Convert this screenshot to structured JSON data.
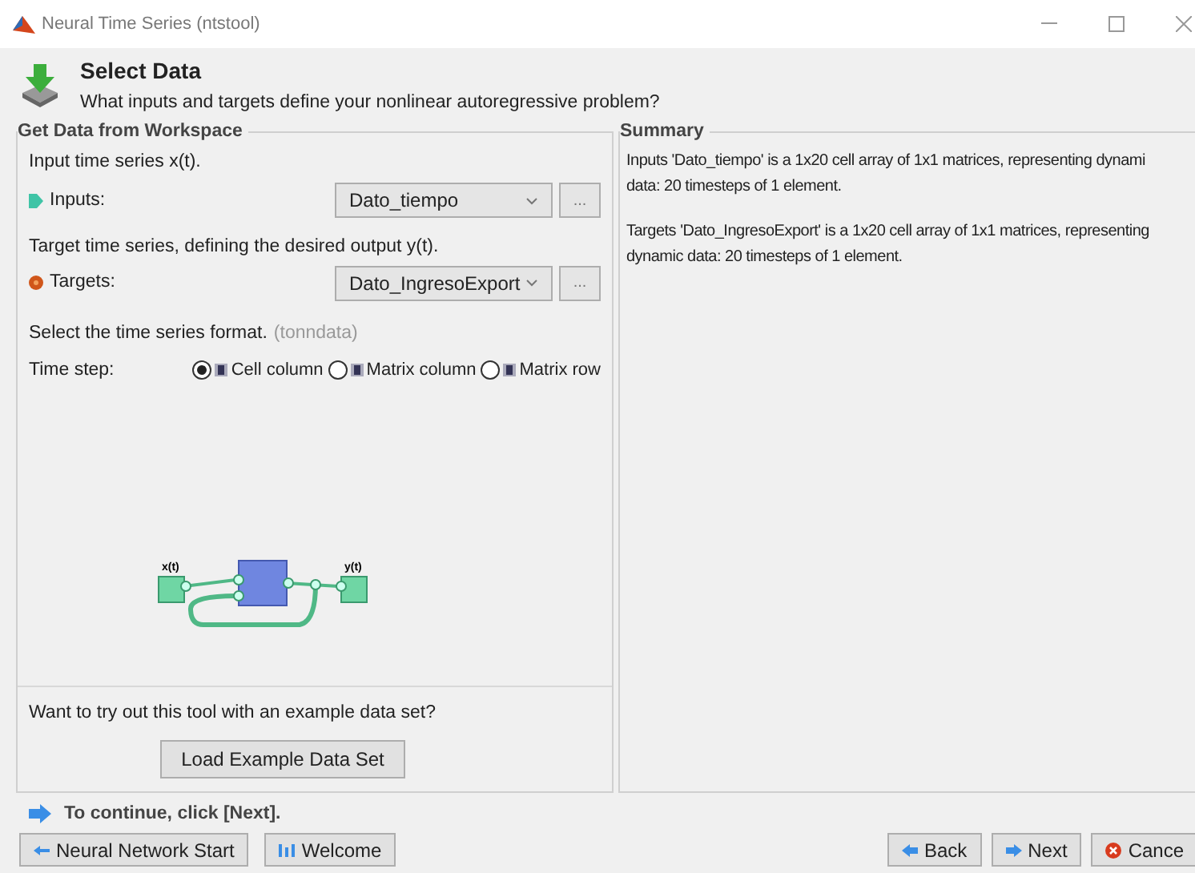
{
  "window": {
    "title": "Neural Time Series (ntstool)"
  },
  "header": {
    "title": "Select Data",
    "subtitle": "What inputs and targets define your nonlinear autoregressive problem?"
  },
  "workspace_panel": {
    "title": "Get Data from Workspace",
    "input_hint": "Input time series x(t).",
    "inputs_label": "Inputs:",
    "inputs_value": "Dato_tiempo",
    "inputs_browse": "...",
    "target_hint": "Target time series, defining the desired output y(t).",
    "targets_label": "Targets:",
    "targets_value": "Dato_IngresoExport",
    "targets_browse": "...",
    "format_hint": "Select the time series format.",
    "format_code": "(tonndata)",
    "time_step_label": "Time step:",
    "time_step_options": [
      {
        "label": "Cell column",
        "selected": true
      },
      {
        "label": "Matrix column",
        "selected": false
      },
      {
        "label": "Matrix row",
        "selected": false
      }
    ],
    "diagram_labels": [
      "x(t)",
      "y(t)"
    ],
    "example_prompt": "Want to try out this tool with an example data set?",
    "example_button": "Load Example Data Set"
  },
  "summary_panel": {
    "title": "Summary",
    "paragraphs": [
      "Inputs 'Dato_tiempo' is a 1x20 cell array of 1x1 matrices, representing dynami\ndata: 20 timesteps of 1 element.",
      "Targets 'Dato_IngresoExport' is a 1x20 cell array of 1x1 matrices, representing\ndynamic data: 20 timesteps of 1 element."
    ]
  },
  "footer": {
    "hint": "To continue, click [Next].",
    "left_buttons": [
      "Neural Network Start",
      "Welcome"
    ],
    "right_buttons": [
      "Back",
      "Next",
      "Cance"
    ]
  }
}
